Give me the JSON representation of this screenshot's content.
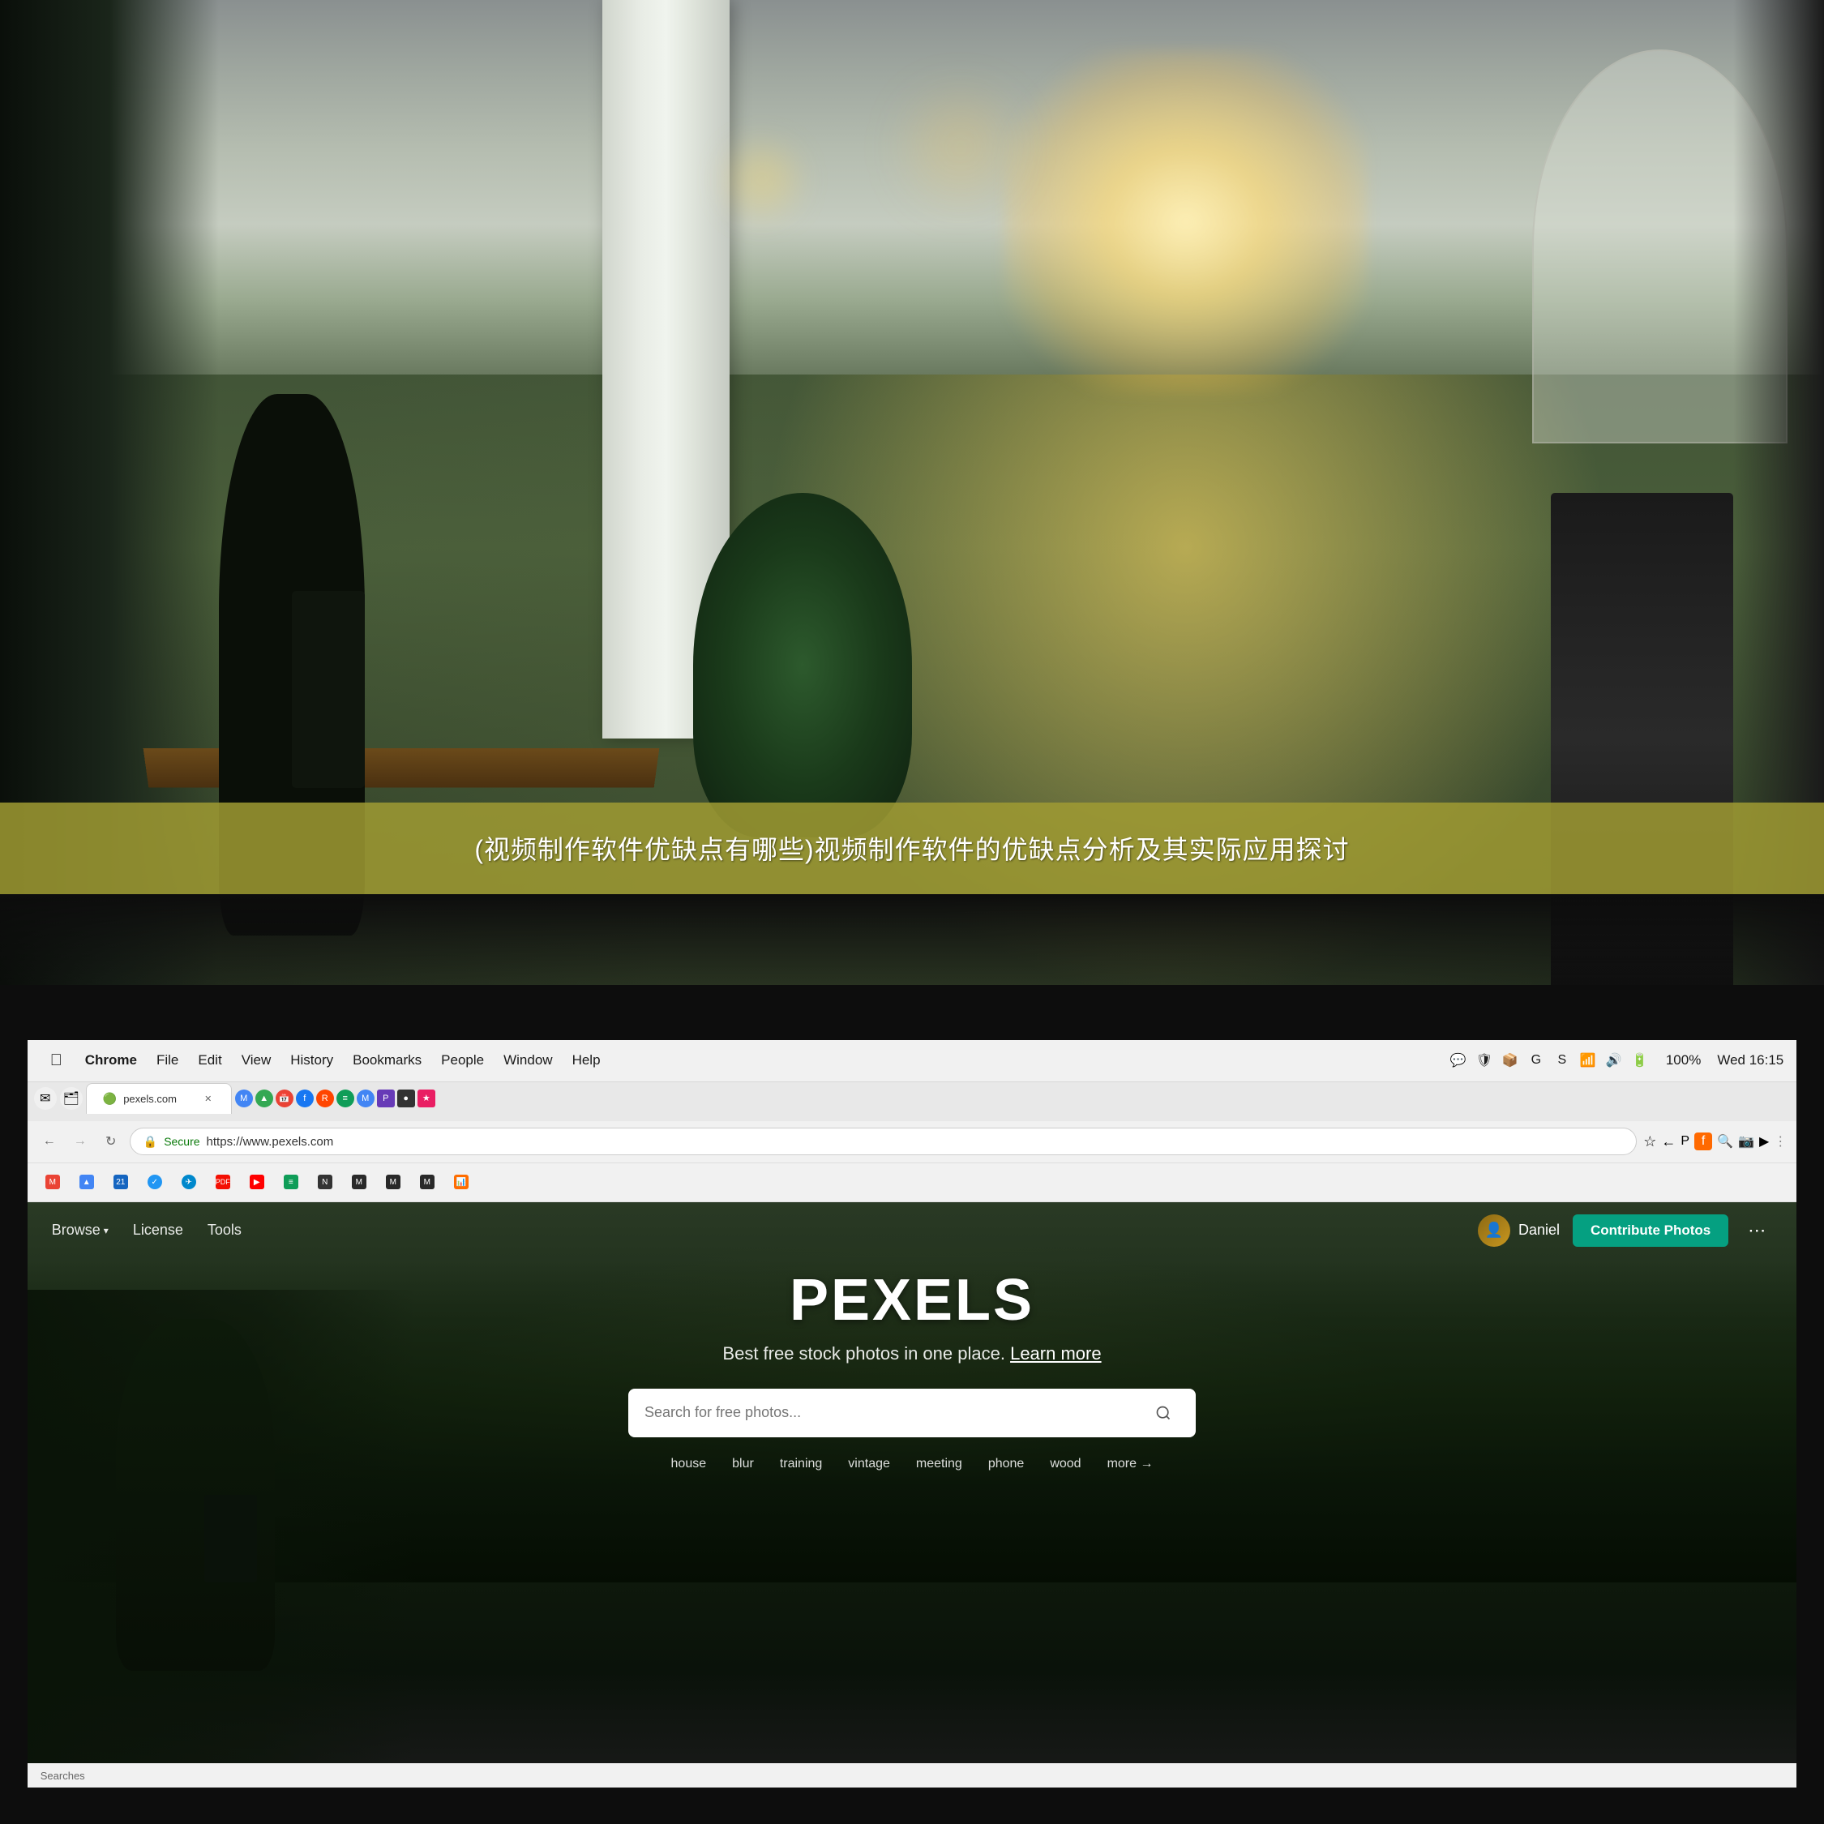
{
  "photo_scene": {
    "banner_text": "(视频制作软件优缺点有哪些)视频制作软件的优缺点分析及其实际应用探讨"
  },
  "macos": {
    "menu_items": [
      "",
      "Chrome",
      "File",
      "Edit",
      "View",
      "History",
      "Bookmarks",
      "People",
      "Window",
      "Help"
    ],
    "time": "Wed 16:15",
    "battery": "100%",
    "wifi": "WiFi"
  },
  "chrome": {
    "tab_title": "pexels.com",
    "url": "https://www.pexels.com",
    "url_display": "https://www.pexels.com",
    "secure_label": "Secure"
  },
  "pexels": {
    "title": "PEXELS",
    "subtitle": "Best free stock photos in one place.",
    "learn_more": "Learn more",
    "search_placeholder": "Search for free photos...",
    "nav": {
      "browse": "Browse",
      "license": "License",
      "tools": "Tools",
      "user": "Daniel",
      "contribute": "Contribute Photos"
    },
    "quick_tags": [
      "house",
      "blur",
      "training",
      "vintage",
      "meeting",
      "phone",
      "wood",
      "more →"
    ],
    "more_label": "more →"
  },
  "status_bar": {
    "searches_label": "Searches"
  }
}
